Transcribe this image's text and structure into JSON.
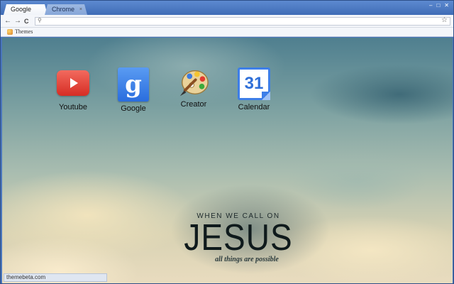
{
  "tabs": [
    {
      "label": "Google",
      "active": true
    },
    {
      "label": "Chrome",
      "active": false
    }
  ],
  "window_controls": {
    "minimize": "–",
    "maximize": "□",
    "close": "✕"
  },
  "toolbar": {
    "back": "←",
    "forward": "→",
    "reload": "C",
    "address_value": "",
    "star": "☆"
  },
  "bookmarks": [
    {
      "label": "Themes",
      "icon": "palette-icon"
    }
  ],
  "apps": [
    {
      "label": "Youtube",
      "icon": "youtube-play-icon"
    },
    {
      "label": "Google",
      "icon": "google-g-icon",
      "glyph": "g"
    },
    {
      "label": "Creator",
      "icon": "paint-palette-icon"
    },
    {
      "label": "Calendar",
      "icon": "calendar-icon",
      "glyph": "31"
    }
  ],
  "wallpaper_text": {
    "line1": "WHEN WE CALL ON",
    "line2": "JESUS",
    "line3": "all things are possible"
  },
  "status_bar": {
    "text": "themebeta.com"
  },
  "colors": {
    "frame": "#4a76bd",
    "youtube_red": "#d62d24",
    "google_blue": "#2a6dde",
    "calendar_blue": "#3d7ee8"
  }
}
